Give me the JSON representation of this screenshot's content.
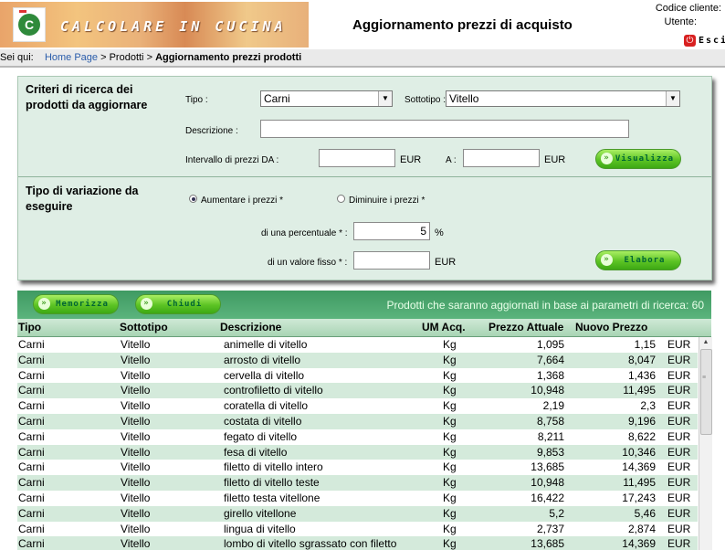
{
  "header": {
    "brand": "CALCOLARE IN CUCINA",
    "title": "Aggiornamento prezzi di acquisto",
    "codice_cliente_label": "Codice cliente:",
    "utente_label": "Utente:",
    "exit_label": "Esci",
    "logo_letter": "C"
  },
  "breadcrumb": {
    "prefix": "Sei qui:",
    "home": "Home Page",
    "sep1": ">",
    "prodotti": "Prodotti",
    "sep2": ">",
    "current": "Aggiornamento prezzi prodotti"
  },
  "criteria": {
    "heading": "Criteri di ricerca dei prodotti da aggiornare",
    "tipo_label": "Tipo :",
    "tipo_value": "Carni",
    "sottotipo_label": "Sottotipo :",
    "sottotipo_value": "Vitello",
    "descrizione_label": "Descrizione :",
    "descrizione_value": "",
    "intervallo_label": "Intervallo di prezzi DA :",
    "da_value": "",
    "eur1": "EUR",
    "a_label": "A :",
    "a_value": "",
    "eur2": "EUR",
    "visualizza_label": "Visualizza"
  },
  "variation": {
    "heading": "Tipo di variazione da eseguire",
    "aumentare_label": "Aumentare i prezzi *",
    "diminuire_label": "Diminuire i prezzi *",
    "selected": "aumentare",
    "percentuale_label": "di una percentuale * :",
    "percentuale_value": "5",
    "percent_sign": "%",
    "valore_label": "di un valore fisso * :",
    "valore_value": "",
    "eur": "EUR",
    "elabora_label": "Elabora"
  },
  "results": {
    "memorizza_label": "Memorizza",
    "chiudi_label": "Chiudi",
    "count_text": "Prodotti che saranno aggiornati in base ai parametri di ricerca: 60",
    "columns": [
      "Tipo",
      "Sottotipo",
      "Descrizione",
      "UM Acq.",
      "Prezzo Attuale",
      "Nuovo Prezzo"
    ],
    "rows": [
      [
        "Carni",
        "Vitello",
        "animelle di vitello",
        "Kg",
        "1,095",
        "1,15",
        "EUR"
      ],
      [
        "Carni",
        "Vitello",
        "arrosto di vitello",
        "Kg",
        "7,664",
        "8,047",
        "EUR"
      ],
      [
        "Carni",
        "Vitello",
        "cervella di vitello",
        "Kg",
        "1,368",
        "1,436",
        "EUR"
      ],
      [
        "Carni",
        "Vitello",
        "controfiletto di vitello",
        "Kg",
        "10,948",
        "11,495",
        "EUR"
      ],
      [
        "Carni",
        "Vitello",
        "coratella di vitello",
        "Kg",
        "2,19",
        "2,3",
        "EUR"
      ],
      [
        "Carni",
        "Vitello",
        "costata di vitello",
        "Kg",
        "8,758",
        "9,196",
        "EUR"
      ],
      [
        "Carni",
        "Vitello",
        "fegato di vitello",
        "Kg",
        "8,211",
        "8,622",
        "EUR"
      ],
      [
        "Carni",
        "Vitello",
        "fesa di vitello",
        "Kg",
        "9,853",
        "10,346",
        "EUR"
      ],
      [
        "Carni",
        "Vitello",
        "filetto di vitello intero",
        "Kg",
        "13,685",
        "14,369",
        "EUR"
      ],
      [
        "Carni",
        "Vitello",
        "filetto di vitello teste",
        "Kg",
        "10,948",
        "11,495",
        "EUR"
      ],
      [
        "Carni",
        "Vitello",
        "filetto testa vitellone",
        "Kg",
        "16,422",
        "17,243",
        "EUR"
      ],
      [
        "Carni",
        "Vitello",
        "girello vitellone",
        "Kg",
        "5,2",
        "5,46",
        "EUR"
      ],
      [
        "Carni",
        "Vitello",
        "lingua di vitello",
        "Kg",
        "2,737",
        "2,874",
        "EUR"
      ],
      [
        "Carni",
        "Vitello",
        "lombo di vitello sgrassato con filetto",
        "Kg",
        "13,685",
        "14,369",
        "EUR"
      ]
    ]
  },
  "colors": {
    "panel_bg": "#dfeee5",
    "toolbar_green": "#4aa76e",
    "row_alt": "#d4eadb",
    "button_green": "#5cc324",
    "exit_red": "#d82020"
  }
}
